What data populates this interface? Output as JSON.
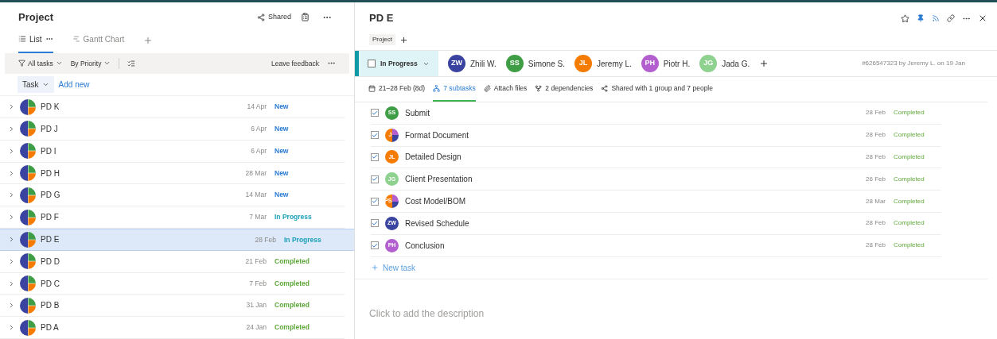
{
  "left": {
    "title": "Project",
    "shared": "Shared",
    "tabs": [
      {
        "label": "List",
        "selected": true
      },
      {
        "label": "Gantt Chart",
        "selected": false
      }
    ],
    "filters": [
      "All tasks",
      "By Priority"
    ],
    "feedback": "Leave feedback",
    "task_button": "Task",
    "add_new": "Add new",
    "rows": [
      {
        "name": "PD K",
        "date": "14 Apr",
        "status": "New",
        "kind": "new",
        "selected": false
      },
      {
        "name": "PD J",
        "date": "6 Apr",
        "status": "New",
        "kind": "new",
        "selected": false
      },
      {
        "name": "PD I",
        "date": "6 Apr",
        "status": "New",
        "kind": "new",
        "selected": false
      },
      {
        "name": "PD H",
        "date": "28 Mar",
        "status": "New",
        "kind": "new",
        "selected": false
      },
      {
        "name": "PD G",
        "date": "14 Mar",
        "status": "New",
        "kind": "new",
        "selected": false
      },
      {
        "name": "PD F",
        "date": "7 Mar",
        "status": "In Progress",
        "kind": "in_progress",
        "selected": false
      },
      {
        "name": "PD E",
        "date": "28 Feb",
        "status": "In Progress",
        "kind": "in_progress",
        "selected": true
      },
      {
        "name": "PD D",
        "date": "21 Feb",
        "status": "Completed",
        "kind": "completed",
        "selected": false
      },
      {
        "name": "PD C",
        "date": "7 Feb",
        "status": "Completed",
        "kind": "completed",
        "selected": false
      },
      {
        "name": "PD B",
        "date": "31 Jan",
        "status": "Completed",
        "kind": "completed",
        "selected": false
      },
      {
        "name": "PD A",
        "date": "24 Jan",
        "status": "Completed",
        "kind": "completed",
        "selected": false
      }
    ]
  },
  "detail": {
    "title": "PD E",
    "tag": "Project",
    "status": "In Progress",
    "checked": false,
    "people": [
      {
        "initials": "ZW",
        "name": "Zhili W.",
        "color": "#3a44a0"
      },
      {
        "initials": "SS",
        "name": "Simone S.",
        "color": "#3f9e45"
      },
      {
        "initials": "JL",
        "name": "Jeremy L.",
        "color": "#f57c00"
      },
      {
        "initials": "PH",
        "name": "Piotr H.",
        "color": "#b45fcf"
      },
      {
        "initials": "JG",
        "name": "Jada G.",
        "color": "#8fd18f"
      }
    ],
    "meta": "#626547323 by Jeremy L. on 19 Jan",
    "info": [
      {
        "kind": "date",
        "label": "21–28 Feb (8d)",
        "selected": false
      },
      {
        "kind": "subtasks",
        "label": "7 subtasks",
        "selected": true
      },
      {
        "kind": "attach",
        "label": "Attach files",
        "selected": false
      },
      {
        "kind": "dependencies",
        "label": "2 dependencies",
        "selected": false
      },
      {
        "kind": "shared",
        "label": "Shared with 1 group and 7 people",
        "selected": false
      }
    ],
    "subtasks": [
      {
        "name": "Submit",
        "date": "28 Feb",
        "status": "Completed",
        "checked": true,
        "avatar": {
          "kind": "single",
          "initials": "SS",
          "color": "#3f9e45"
        }
      },
      {
        "name": "Format Document",
        "date": "28 Feb",
        "status": "Completed",
        "checked": true,
        "avatar": {
          "kind": "split",
          "initials": "J"
        }
      },
      {
        "name": "Detailed Design",
        "date": "28 Feb",
        "status": "Completed",
        "checked": true,
        "avatar": {
          "kind": "single",
          "initials": "JL",
          "color": "#f57c00"
        }
      },
      {
        "name": "Client Presentation",
        "date": "26 Feb",
        "status": "Completed",
        "checked": true,
        "avatar": {
          "kind": "single",
          "initials": "JG",
          "color": "#8fd18f"
        }
      },
      {
        "name": "Cost Model/BOM",
        "date": "28 Mar",
        "status": "Completed",
        "checked": true,
        "avatar": {
          "kind": "split",
          "initials": "PS"
        }
      },
      {
        "name": "Revised Schedule",
        "date": "28 Feb",
        "status": "Completed",
        "checked": true,
        "avatar": {
          "kind": "single",
          "initials": "ZW",
          "color": "#3a44a0"
        }
      },
      {
        "name": "Conclusion",
        "date": "28 Feb",
        "status": "Completed",
        "checked": true,
        "avatar": {
          "kind": "single",
          "initials": "PH",
          "color": "#b45fcf"
        }
      }
    ],
    "new_task": "New task",
    "description_placeholder": "Click to add the description"
  }
}
